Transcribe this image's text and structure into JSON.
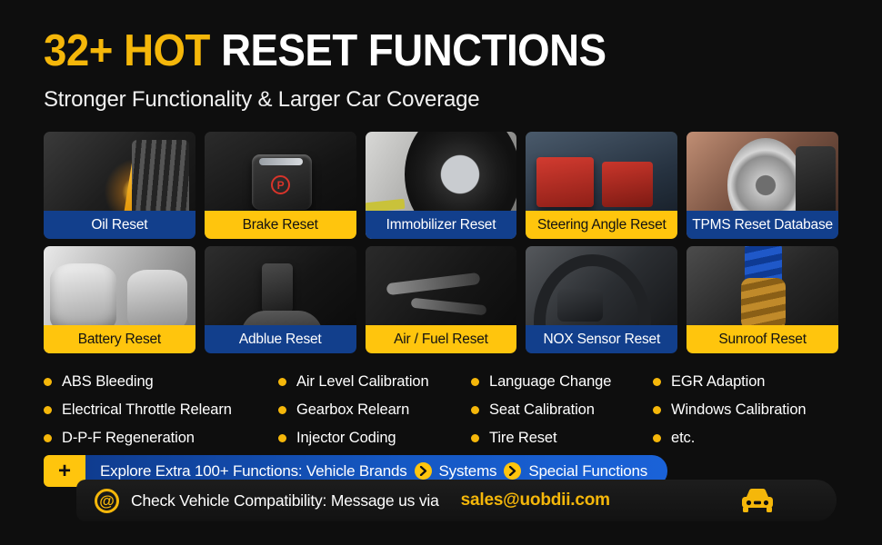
{
  "header": {
    "headline_highlight": "32+ HOT",
    "headline_rest": "RESET FUNCTIONS",
    "subheadline": "Stronger Functionality & Larger Car Coverage"
  },
  "colors": {
    "background": "#0e0e0e",
    "accent_yellow": "#ffc50d",
    "headline_yellow": "#f5b70a",
    "accent_blue": "#123f8c",
    "bar_blue": "#1558c4"
  },
  "cards": [
    {
      "label": "Oil Reset",
      "style": "blue",
      "art": "ph-oil"
    },
    {
      "label": "Brake Reset",
      "style": "yellow",
      "art": "ph-brake"
    },
    {
      "label": "Immobilizer Reset",
      "style": "blue",
      "art": "ph-tire"
    },
    {
      "label": "Steering Angle Reset",
      "style": "yellow",
      "art": "ph-batt"
    },
    {
      "label": "TPMS Reset Database",
      "style": "blue",
      "art": "ph-disc"
    },
    {
      "label": "Battery Reset",
      "style": "yellow",
      "art": "ph-exh"
    },
    {
      "label": "Adblue Reset",
      "style": "blue",
      "art": "ph-key"
    },
    {
      "label": "Air / Fuel Reset",
      "style": "yellow",
      "art": "ph-inj"
    },
    {
      "label": "NOX Sensor Reset",
      "style": "blue",
      "art": "ph-whl"
    },
    {
      "label": "Sunroof Reset",
      "style": "yellow",
      "art": "ph-susp"
    }
  ],
  "bullet_columns": [
    {
      "items": [
        "ABS Bleeding",
        "Electrical Throttle Relearn",
        "D-P-F Regeneration"
      ]
    },
    {
      "items": [
        "Air Level Calibration",
        "Gearbox Relearn",
        "Injector Coding"
      ]
    },
    {
      "items": [
        "Language Change",
        "Seat Calibration",
        "Tire Reset"
      ]
    },
    {
      "items": [
        "EGR Adaption",
        "Windows Calibration",
        "etc."
      ]
    }
  ],
  "explore_bar": {
    "plus_symbol": "+",
    "intro": "Explore Extra 100+ Functions: Vehicle Brands",
    "step_2": "Systems",
    "step_3": "Special Functions"
  },
  "email_bar": {
    "at_symbol": "@",
    "message": "Check Vehicle Compatibility: Message us via",
    "email": "sales@uobdii.com"
  }
}
